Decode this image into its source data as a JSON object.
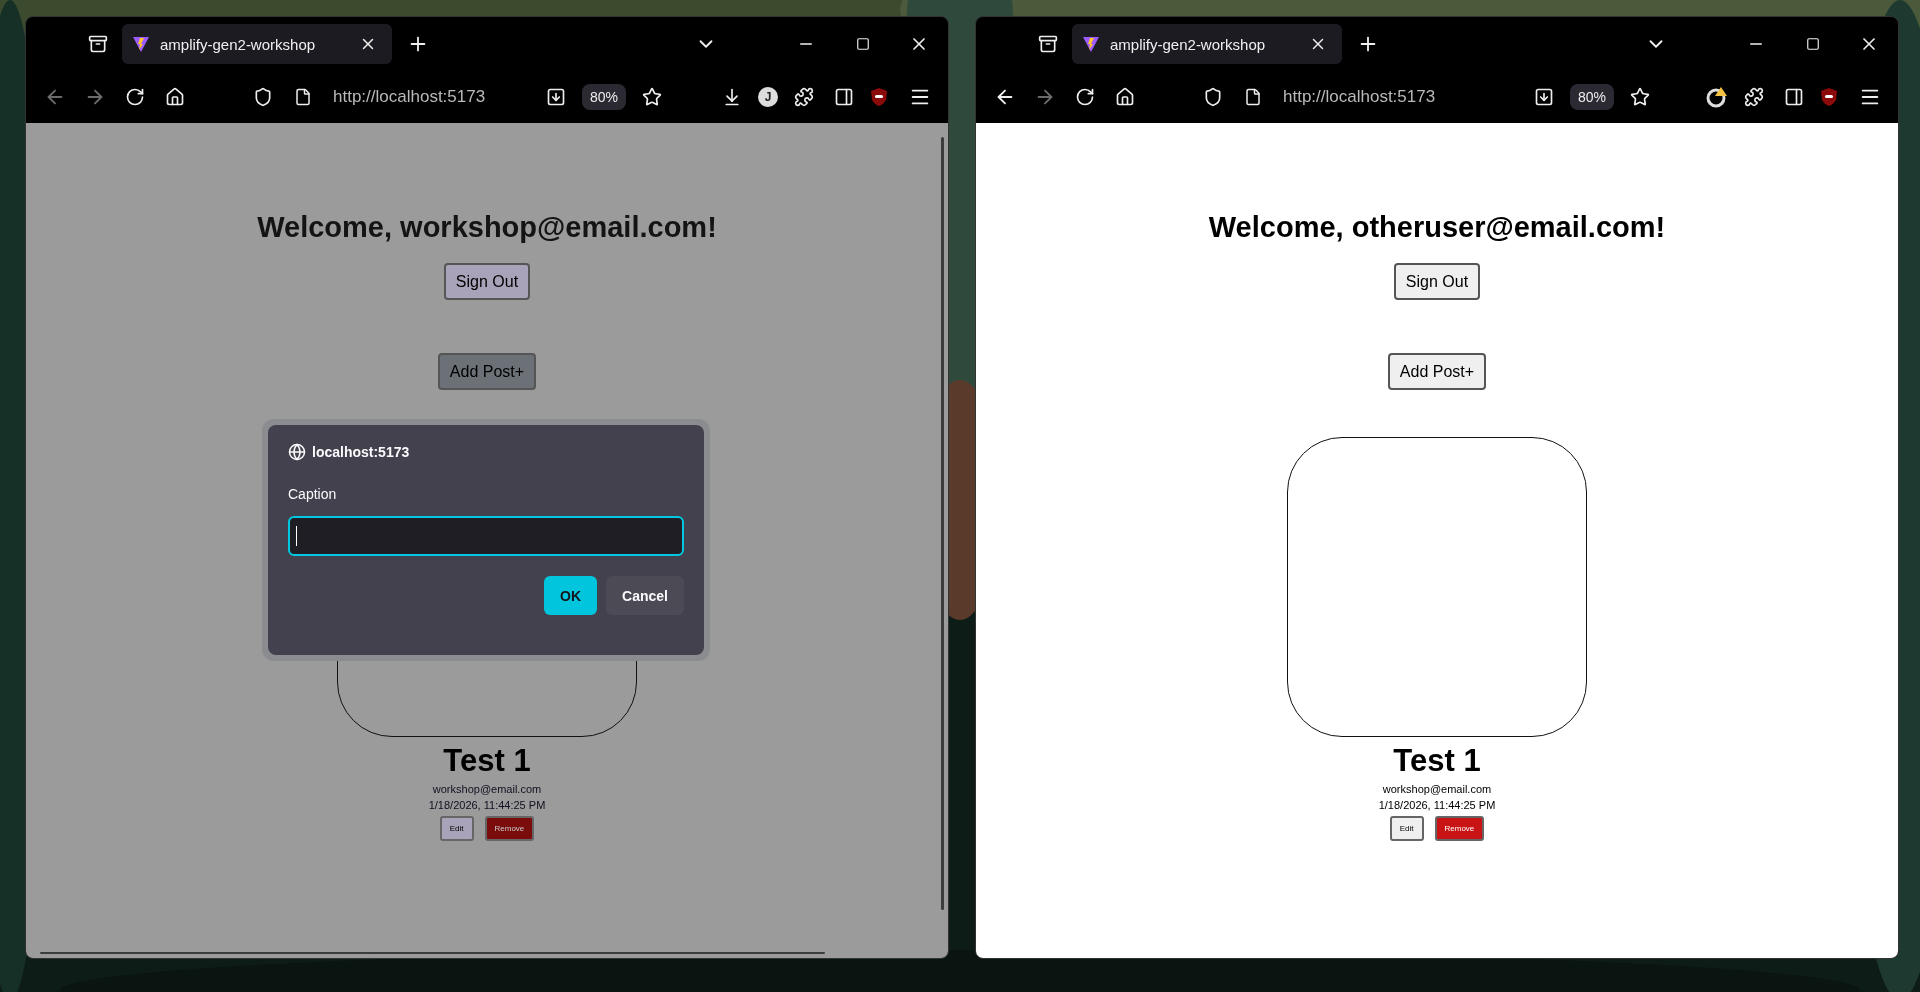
{
  "windows": [
    {
      "tab": {
        "title": "amplify-gen2-workshop"
      },
      "back_disabled": true,
      "forward_disabled": true,
      "address": "http://localhost:5173",
      "zoom": "80%",
      "avatar_initial": "J",
      "dimmed": true,
      "scrollbars": true,
      "page": {
        "heading": "Welcome, workshop@email.com!",
        "sign_out": "Sign Out",
        "add_post": {
          "label": "Add Post+",
          "focused": true
        },
        "posts": [
          {
            "title": "Test 1",
            "author": "workshop@email.com",
            "date": "1/18/2026, 11:44:25 PM",
            "edit": "Edit",
            "remove": "Remove"
          }
        ]
      },
      "dialog": {
        "origin": "localhost:5173",
        "label": "Caption",
        "buttons": [
          {
            "label": "OK",
            "kind": "primary"
          },
          {
            "label": "Cancel",
            "kind": "secondary"
          }
        ]
      }
    },
    {
      "tab": {
        "title": "amplify-gen2-workshop"
      },
      "back_disabled": false,
      "forward_disabled": true,
      "address": "http://localhost:5173",
      "zoom": "80%",
      "dimmed": false,
      "scrollbars": false,
      "page": {
        "heading": "Welcome, otheruser@email.com!",
        "sign_out": "Sign Out",
        "add_post": {
          "label": "Add Post+",
          "focused": false
        },
        "posts": [
          {
            "title": "Test 1",
            "author": "workshop@email.com",
            "date": "1/18/2026, 11:44:25 PM",
            "edit": "Edit",
            "remove": "Remove"
          }
        ]
      }
    }
  ]
}
